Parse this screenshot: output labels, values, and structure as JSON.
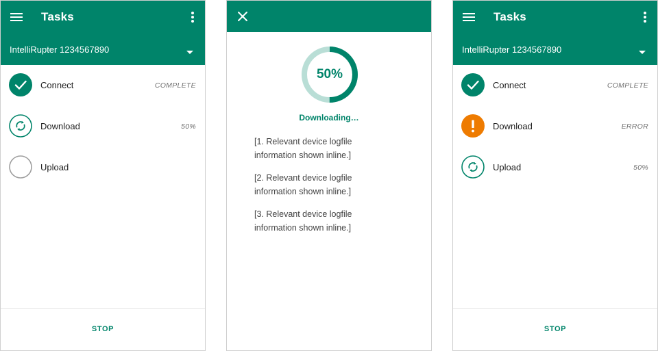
{
  "colors": {
    "primary": "#00846a",
    "primary_light": "#b9ded6",
    "error": "#ee7b00",
    "pending": "#9e9e9e"
  },
  "screens": [
    {
      "header": {
        "title": "Tasks",
        "device": "IntelliRupter 1234567890"
      },
      "tasks": [
        {
          "name": "Connect",
          "status": "COMPLETE",
          "icon": "check-circle-icon"
        },
        {
          "name": "Download",
          "status": "50%",
          "icon": "sync-icon"
        },
        {
          "name": "Upload",
          "status": "",
          "icon": "empty-circle-icon"
        }
      ],
      "footer": {
        "stop_label": "STOP"
      }
    },
    {
      "progress": {
        "percent_label": "50%",
        "percent_value": 50,
        "status": "Downloading…",
        "log": [
          "[1. Relevant device logfile information shown inline.]",
          "[2. Relevant device logfile information shown inline.]",
          "[3. Relevant device logfile information shown inline.]"
        ]
      }
    },
    {
      "header": {
        "title": "Tasks",
        "device": "IntelliRupter 1234567890"
      },
      "tasks": [
        {
          "name": "Connect",
          "status": "COMPLETE",
          "icon": "check-circle-icon"
        },
        {
          "name": "Download",
          "status": "ERROR",
          "icon": "error-icon"
        },
        {
          "name": "Upload",
          "status": "50%",
          "icon": "sync-icon"
        }
      ],
      "footer": {
        "stop_label": "STOP"
      }
    }
  ]
}
